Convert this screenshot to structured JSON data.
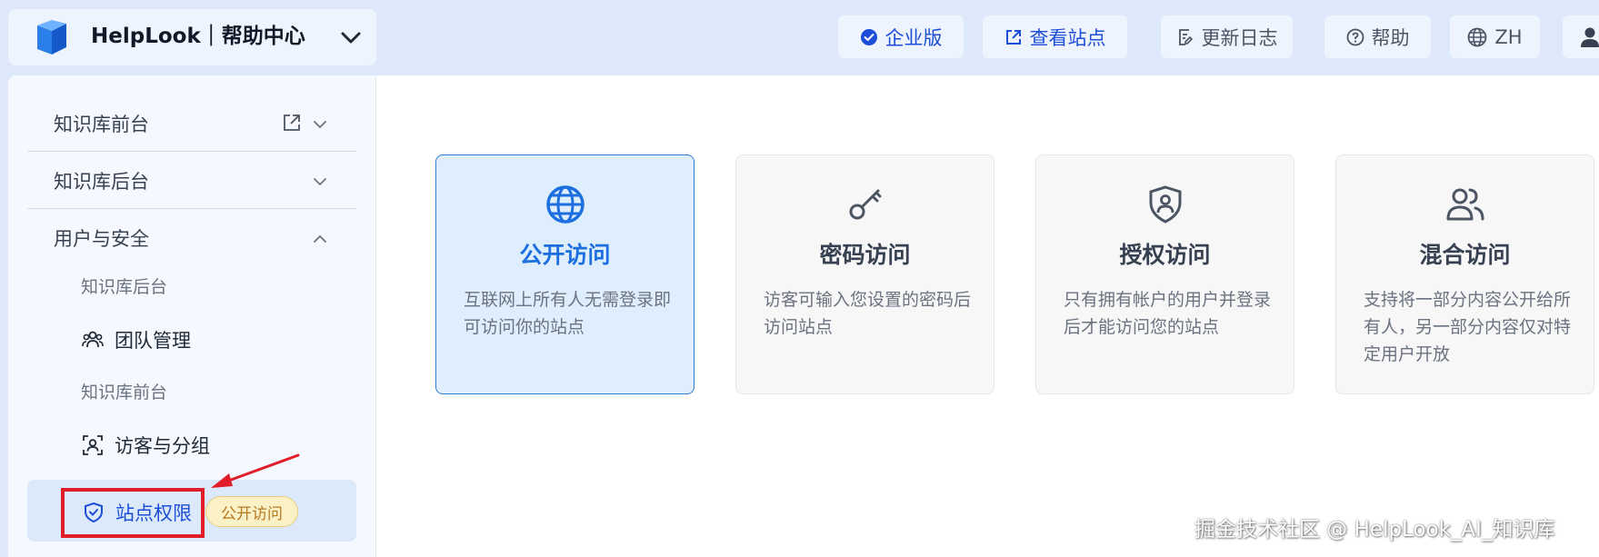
{
  "header": {
    "brand_name": "HelpLook｜帮助中心",
    "buttons": {
      "enterprise": "企业版",
      "view_site": "查看站点",
      "changelog": "更新日志",
      "help": "帮助",
      "language": "ZH"
    }
  },
  "sidebar": {
    "sections": [
      {
        "label": "知识库前台"
      },
      {
        "label": "知识库后台"
      },
      {
        "label": "用户与安全"
      }
    ],
    "groups": {
      "backend_head": "知识库后台",
      "team": "团队管理",
      "frontend_head": "知识库前台",
      "visitors": "访客与分组",
      "site_permission": "站点权限",
      "site_permission_badge": "公开访问"
    }
  },
  "access_modes": [
    {
      "title": "公开访问",
      "desc": "互联网上所有人无需登录即可访问你的站点",
      "icon": "globe-icon",
      "selected": true
    },
    {
      "title": "密码访问",
      "desc": "访客可输入您设置的密码后访问站点",
      "icon": "key-icon",
      "selected": false
    },
    {
      "title": "授权访问",
      "desc": "只有拥有帐户的用户并登录后才能访问您的站点",
      "icon": "shield-user-icon",
      "selected": false
    },
    {
      "title": "混合访问",
      "desc": "支持将一部分内容公开给所有人，另一部分内容仅对特定用户开放",
      "icon": "users-icon",
      "selected": false
    }
  ],
  "watermark": "掘金技术社区 @ HelpLook_AI_知识库",
  "colors": {
    "accent": "#1d6fe0",
    "header_bg": "#dde9fb",
    "highlight_red": "#e11d2a",
    "badge_bg": "#fbf1c7"
  }
}
